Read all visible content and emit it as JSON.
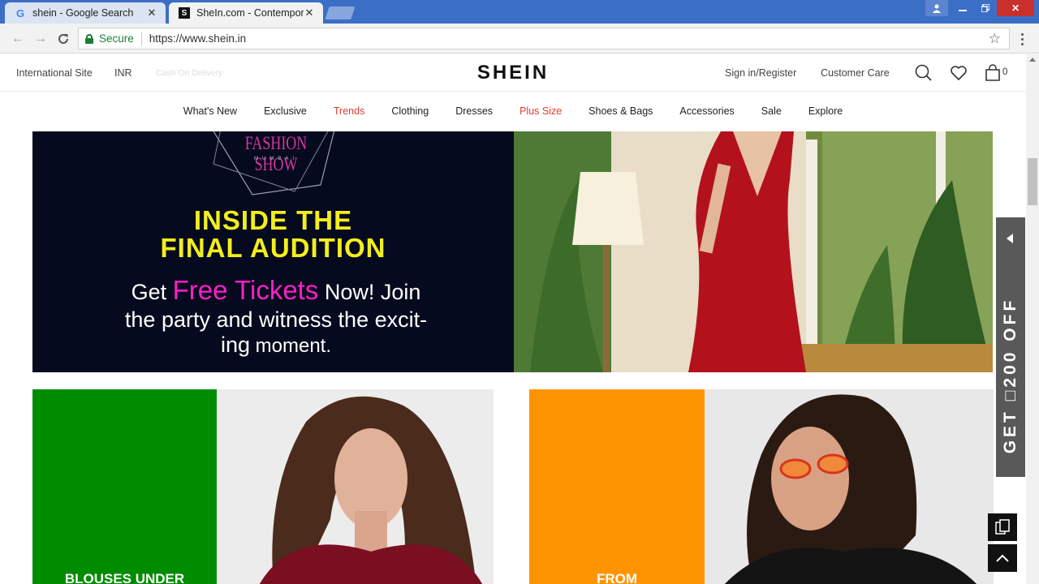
{
  "browser": {
    "tabs": [
      {
        "title": "shein - Google Search",
        "favicon": "G",
        "active": false
      },
      {
        "title": "SheIn.com - Contempora",
        "favicon": "S",
        "active": true
      }
    ],
    "address": {
      "secure_label": "Secure",
      "url": "https://www.shein.in"
    }
  },
  "header": {
    "international_site": "International Site",
    "currency": "INR",
    "cod": "Cash On Delivery",
    "logo": "SHEIN",
    "sign_in": "Sign in/Register",
    "customer_care": "Customer Care",
    "bag_count": "0"
  },
  "nav": {
    "items": [
      {
        "label": "What's New",
        "highlight": false
      },
      {
        "label": "Exclusive",
        "highlight": false
      },
      {
        "label": "Trends",
        "highlight": true
      },
      {
        "label": "Clothing",
        "highlight": false
      },
      {
        "label": "Dresses",
        "highlight": false
      },
      {
        "label": "Plus Size",
        "highlight": true
      },
      {
        "label": "Shoes & Bags",
        "highlight": false
      },
      {
        "label": "Accessories",
        "highlight": false
      },
      {
        "label": "Sale",
        "highlight": false
      },
      {
        "label": "Explore",
        "highlight": false
      }
    ],
    "highlight_color": "#e23a2e"
  },
  "banner": {
    "logo_text": "FASHION SHOW",
    "logo_sub": "MUMBAI",
    "headline_1": "INSIDE THE",
    "headline_2": "FINAL AUDITION",
    "promo_get": "Get",
    "promo_free": "Free Tickets",
    "promo_rest": "Now! Join",
    "promo_line2": "the party and witness the excit-",
    "promo_line3_big": "ing",
    "promo_line3": "moment.",
    "headline_color": "#f3ee1c",
    "accent_color": "#ff1fc4"
  },
  "tiles": [
    {
      "label": "BLOUSES UNDER",
      "color": "#008c00"
    },
    {
      "label": "FROM",
      "color": "#fe9400"
    }
  ],
  "sidebar": {
    "get_off": "GET □200 OFF"
  }
}
